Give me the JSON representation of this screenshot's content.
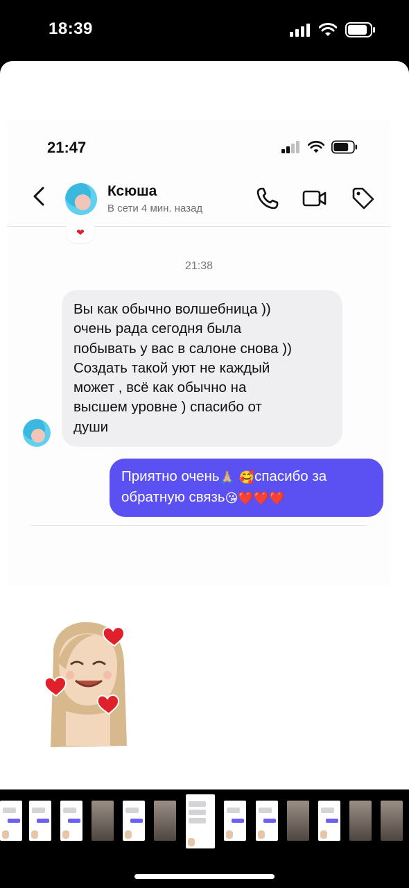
{
  "outer_status": {
    "time": "18:39"
  },
  "inner_status": {
    "time": "21:47"
  },
  "header": {
    "contact_name": "Ксюша",
    "contact_status": "В сети 4 мин. назад"
  },
  "chat": {
    "timestamp": "21:38",
    "incoming": [
      "Вы как обычно волшебница ))",
      "очень рада сегодня была",
      "побывать у вас в салоне снова ))",
      "Создать такой уют не каждый",
      "может , всё как обычно на",
      "высшем уровне ) спасибо от",
      "души"
    ],
    "outgoing": {
      "line1_text_a": "Приятно очень",
      "line1_emoji_a": "🙏🏼",
      "line1_emoji_b": "🥰",
      "line1_text_b": "спасибо за",
      "line2_text": "обратную связь",
      "line2_emojis": "😘❤️❤️❤️"
    }
  },
  "colors": {
    "outgoing_bubble": "#5b51f2",
    "incoming_bubble": "#efeff1",
    "heart": "#e0202a"
  },
  "icons": [
    "back-chevron-icon",
    "phone-icon",
    "video-icon",
    "tag-icon",
    "signal-icon",
    "wifi-icon",
    "battery-icon",
    "heart-reaction-icon",
    "memoji-sticker"
  ]
}
